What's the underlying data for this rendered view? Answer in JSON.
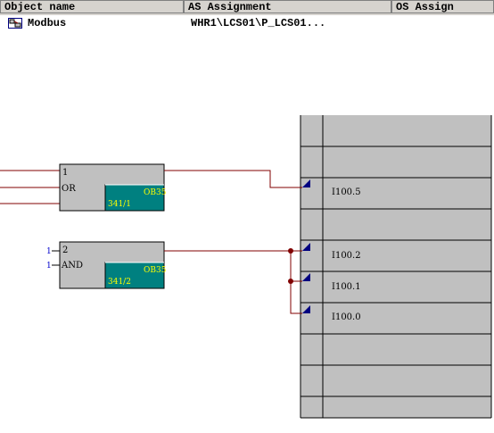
{
  "columns": {
    "object_name": "Object name",
    "as_assignment": "AS Assignment",
    "os_assignment": "OS Assign"
  },
  "row": {
    "object_name": "Modbus",
    "as_assignment": "WHR1\\LCS01\\P_LCS01..."
  },
  "blocks": [
    {
      "number": "1",
      "type": "OR",
      "ob": "OB35",
      "seq": "341/1"
    },
    {
      "number": "2",
      "type": "AND",
      "ob": "OB35",
      "seq": "341/2",
      "inputs": [
        "1",
        "1"
      ]
    }
  ],
  "signals": [
    "I100.5",
    "I100.2",
    "I100.1",
    "I100.0"
  ],
  "colors": {
    "header_bg": "#d6d3ce",
    "sheet_bar": "#c0c0c0",
    "block_bg": "#c0c0c0",
    "ob_box": "#008080",
    "wire": "#800000"
  }
}
